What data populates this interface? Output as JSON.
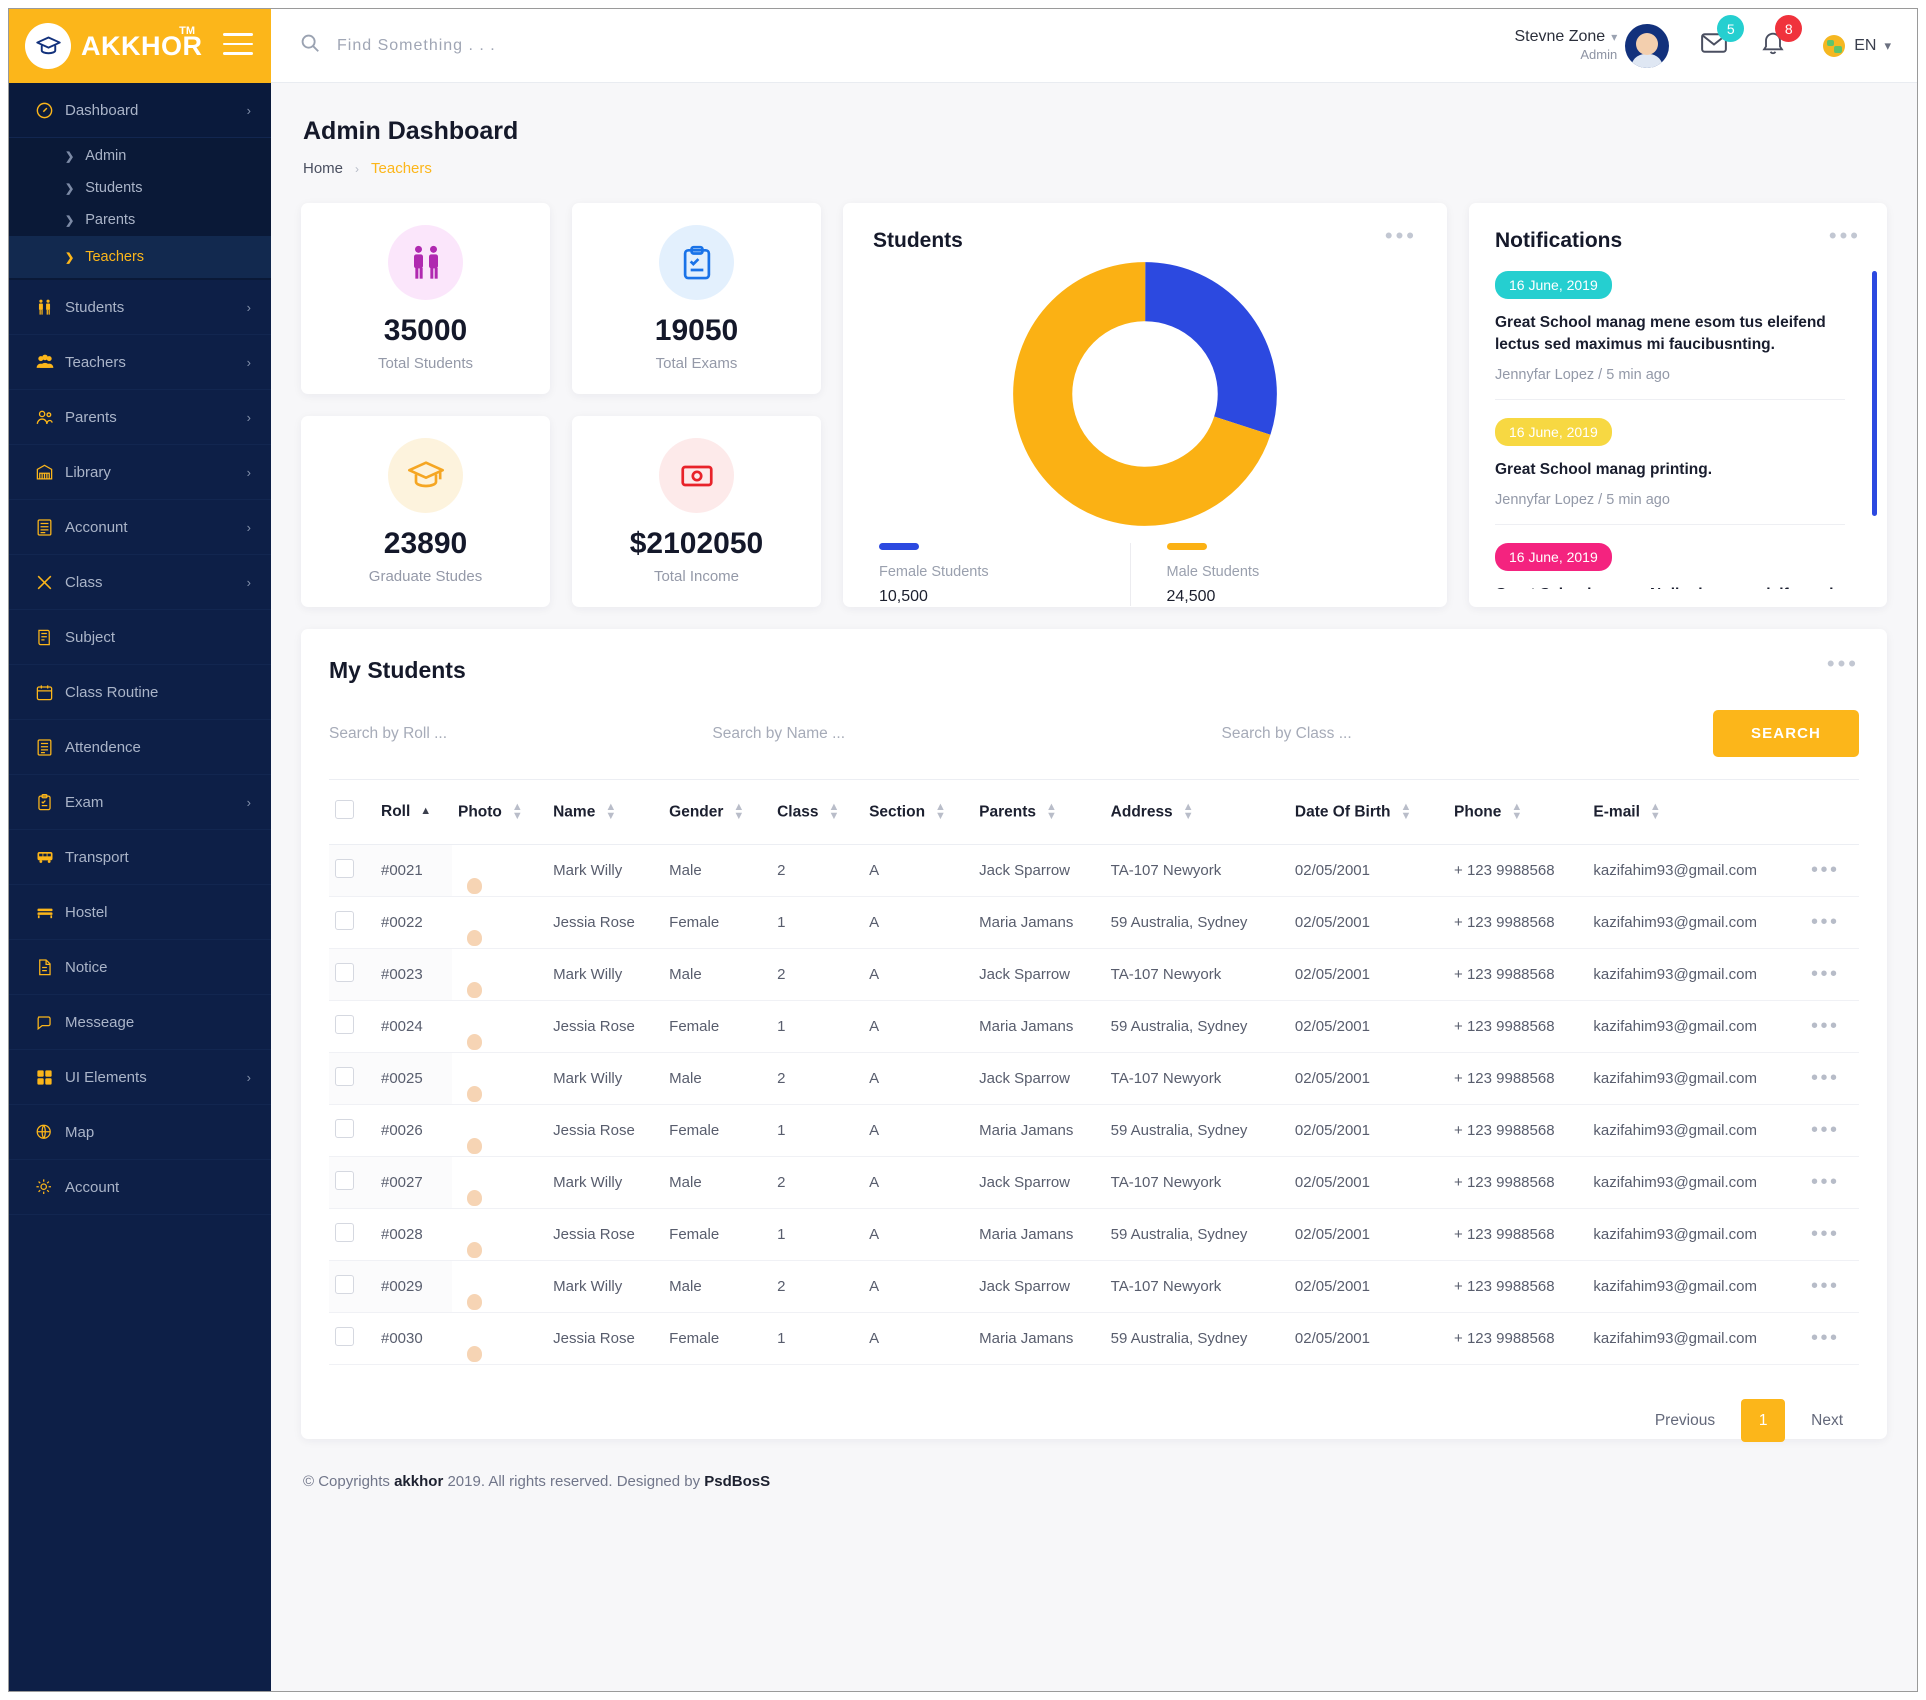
{
  "brand": {
    "name": "AKKHOR",
    "tm": "TM",
    "logo_icon": "graduation-cap-icon"
  },
  "topbar": {
    "search_placeholder": "Find Something . . .",
    "user_name": "Stevne Zone",
    "user_role": "Admin",
    "mail_count": "5",
    "bell_count": "8",
    "lang": "EN",
    "mail_badge_color": "#25cfd0",
    "bell_badge_color": "#f0323c"
  },
  "sidebar": {
    "items": [
      {
        "label": "Dashboard",
        "icon": "speedometer-icon",
        "caret": "›",
        "active": true
      },
      {
        "label": "Students",
        "icon": "students-pair-icon",
        "caret": "›"
      },
      {
        "label": "Teachers",
        "icon": "teachers-group-icon",
        "caret": "›"
      },
      {
        "label": "Parents",
        "icon": "parents-icon",
        "caret": "›"
      },
      {
        "label": "Library",
        "icon": "library-icon",
        "caret": "›"
      },
      {
        "label": "Acconunt",
        "icon": "account-ledger-icon",
        "caret": "›"
      },
      {
        "label": "Class",
        "icon": "pencil-ruler-icon",
        "caret": "›"
      },
      {
        "label": "Subject",
        "icon": "subject-book-icon",
        "caret": ""
      },
      {
        "label": "Class Routine",
        "icon": "calendar-icon",
        "caret": ""
      },
      {
        "label": "Attendence",
        "icon": "attendance-list-icon",
        "caret": ""
      },
      {
        "label": "Exam",
        "icon": "exam-clipboard-icon",
        "caret": "›"
      },
      {
        "label": "Transport",
        "icon": "bus-icon",
        "caret": ""
      },
      {
        "label": "Hostel",
        "icon": "bed-icon",
        "caret": ""
      },
      {
        "label": "Notice",
        "icon": "notice-doc-icon",
        "caret": ""
      },
      {
        "label": "Messeage",
        "icon": "chat-bubble-icon",
        "caret": ""
      },
      {
        "label": "UI Elements",
        "icon": "grid-squares-icon",
        "caret": "›"
      },
      {
        "label": "Map",
        "icon": "map-globe-icon",
        "caret": ""
      },
      {
        "label": "Account",
        "icon": "gear-icon",
        "caret": ""
      }
    ],
    "submenu": [
      {
        "label": "Admin",
        "selected": false
      },
      {
        "label": "Students",
        "selected": false
      },
      {
        "label": "Parents",
        "selected": false
      },
      {
        "label": "Teachers",
        "selected": true
      }
    ]
  },
  "page": {
    "title": "Admin Dashboard",
    "breadcrumb_home": "Home",
    "breadcrumb_sep": "›",
    "breadcrumb_current": "Teachers"
  },
  "stats": [
    {
      "value": "35000",
      "label": "Total Students",
      "icon": "students-pair-icon",
      "icon_color": "#b02ab0",
      "bg": "#fbe6fb"
    },
    {
      "value": "19050",
      "label": "Total Exams",
      "icon": "exam-clipboard-icon",
      "icon_color": "#1a73e8",
      "bg": "#e3f0fd"
    },
    {
      "value": "23890",
      "label": "Graduate Studes",
      "icon": "graduation-cap-icon",
      "icon_color": "#f5a623",
      "bg": "#fdf3dd"
    },
    {
      "value": "$2102050",
      "label": "Total Income",
      "icon": "money-bill-icon",
      "icon_color": "#e8232a",
      "bg": "#fdeaea"
    }
  ],
  "chart_data": {
    "type": "pie",
    "title": "Students",
    "donut": true,
    "labels": [
      "Female Students",
      "Male Students"
    ],
    "values": [
      10500,
      24500
    ],
    "value_labels": [
      "10,500",
      "24,500"
    ],
    "colors": [
      "#2c49e0",
      "#fbb114"
    ],
    "total": 35000,
    "legend_position": "bottom",
    "menu_icon": "ellipsis-icon"
  },
  "notifications": {
    "title": "Notifications",
    "menu_icon": "ellipsis-icon",
    "items": [
      {
        "date": "16 June, 2019",
        "date_color": "#25cfd0",
        "text": "Great School manag mene esom tus eleifend lectus sed maximus mi faucibusnting.",
        "meta": "Jennyfar Lopez / 5 min ago"
      },
      {
        "date": "16 June, 2019",
        "date_color": "#f7d842",
        "text": "Great School manag printing.",
        "meta": "Jennyfar Lopez / 5 min ago"
      },
      {
        "date": "16 June, 2019",
        "date_color": "#f4237f",
        "text": "Great School manag Nulla rhoncus eleifensed mim us mi",
        "meta": ""
      }
    ]
  },
  "students_table": {
    "title": "My Students",
    "menu_icon": "ellipsis-icon",
    "filters": [
      {
        "placeholder": "Search by Roll ..."
      },
      {
        "placeholder": "Search by Name ..."
      },
      {
        "placeholder": "Search by Class ..."
      }
    ],
    "search_button": "SEARCH",
    "columns": [
      "Roll",
      "Photo",
      "Name",
      "Gender",
      "Class",
      "Section",
      "Parents",
      "Address",
      "Date Of Birth",
      "Phone",
      "E-mail"
    ],
    "sorted_column": "Roll",
    "sort_direction": "asc",
    "rows": [
      {
        "roll": "#0021",
        "avatar": "#8dc63f",
        "name": "Mark Willy",
        "gender": "Male",
        "class": "2",
        "section": "A",
        "parents": "Jack Sparrow",
        "address": "TA-107 Newyork",
        "dob": "02/05/2001",
        "phone": "+ 123 9988568",
        "email": "kazifahim93@gmail.com"
      },
      {
        "roll": "#0022",
        "avatar": "#00b8e0",
        "name": "Jessia Rose",
        "gender": "Female",
        "class": "1",
        "section": "A",
        "parents": "Maria Jamans",
        "address": "59 Australia, Sydney",
        "dob": "02/05/2001",
        "phone": "+ 123 9988568",
        "email": "kazifahim93@gmail.com"
      },
      {
        "roll": "#0023",
        "avatar": "#f5005e",
        "name": "Mark Willy",
        "gender": "Male",
        "class": "2",
        "section": "A",
        "parents": "Jack Sparrow",
        "address": "TA-107 Newyork",
        "dob": "02/05/2001",
        "phone": "+ 123 9988568",
        "email": "kazifahim93@gmail.com"
      },
      {
        "roll": "#0024",
        "avatar": "#f5b721",
        "name": "Jessia Rose",
        "gender": "Female",
        "class": "1",
        "section": "A",
        "parents": "Maria Jamans",
        "address": "59 Australia, Sydney",
        "dob": "02/05/2001",
        "phone": "+ 123 9988568",
        "email": "kazifahim93@gmail.com"
      },
      {
        "roll": "#0025",
        "avatar": "#7b3fd4",
        "name": "Mark Willy",
        "gender": "Male",
        "class": "2",
        "section": "A",
        "parents": "Jack Sparrow",
        "address": "TA-107 Newyork",
        "dob": "02/05/2001",
        "phone": "+ 123 9988568",
        "email": "kazifahim93@gmail.com"
      },
      {
        "roll": "#0026",
        "avatar": "#22c8c0",
        "name": "Jessia Rose",
        "gender": "Female",
        "class": "1",
        "section": "A",
        "parents": "Maria Jamans",
        "address": "59 Australia, Sydney",
        "dob": "02/05/2001",
        "phone": "+ 123 9988568",
        "email": "kazifahim93@gmail.com"
      },
      {
        "roll": "#0027",
        "avatar": "#e77ec9",
        "name": "Mark Willy",
        "gender": "Male",
        "class": "2",
        "section": "A",
        "parents": "Jack Sparrow",
        "address": "TA-107 Newyork",
        "dob": "02/05/2001",
        "phone": "+ 123 9988568",
        "email": "kazifahim93@gmail.com"
      },
      {
        "roll": "#0028",
        "avatar": "#f0753a",
        "name": "Jessia Rose",
        "gender": "Female",
        "class": "1",
        "section": "A",
        "parents": "Maria Jamans",
        "address": "59 Australia, Sydney",
        "dob": "02/05/2001",
        "phone": "+ 123 9988568",
        "email": "kazifahim93@gmail.com"
      },
      {
        "roll": "#0029",
        "avatar": "#c7ccd4",
        "name": "Mark Willy",
        "gender": "Male",
        "class": "2",
        "section": "A",
        "parents": "Jack Sparrow",
        "address": "TA-107 Newyork",
        "dob": "02/05/2001",
        "phone": "+ 123 9988568",
        "email": "kazifahim93@gmail.com"
      },
      {
        "roll": "#0030",
        "avatar": "#8b3fd4",
        "name": "Jessia Rose",
        "gender": "Female",
        "class": "1",
        "section": "A",
        "parents": "Maria Jamans",
        "address": "59 Australia, Sydney",
        "dob": "02/05/2001",
        "phone": "+ 123 9988568",
        "email": "kazifahim93@gmail.com"
      }
    ],
    "pagination": {
      "previous": "Previous",
      "current": "1",
      "next": "Next"
    }
  },
  "footer": {
    "pre": "© Copyrights ",
    "brand": "akkhor",
    "post": " 2019. All rights reserved. Designed by ",
    "designer": "PsdBosS"
  }
}
